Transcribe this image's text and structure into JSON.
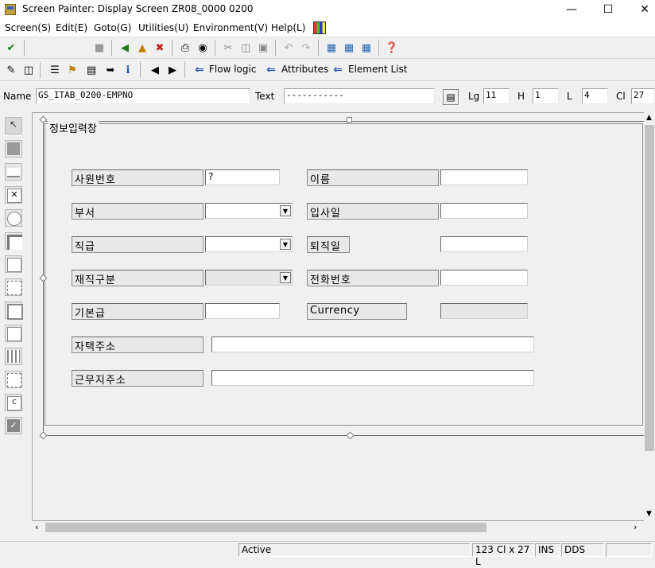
{
  "window": {
    "title": "Screen Painter:  Display Screen ZR08_0000 0200"
  },
  "menubar": {
    "items": [
      "Screen(S)",
      "Edit(E)",
      "Goto(G)",
      "Utilities(U)",
      "Environment(V)",
      "Help(L)"
    ]
  },
  "toolbar2": {
    "flow_logic": "Flow logic",
    "attributes": "Attributes",
    "element_list": "Element List"
  },
  "namerow": {
    "name_label": "Name",
    "name_value": "GS_ITAB_0200-EMPNO",
    "text_label": "Text",
    "text_value": "-----------",
    "lg_label": "Lg",
    "lg_value": "11",
    "h_label": "H",
    "h_value": "1",
    "l_label": "L",
    "l_value": "4",
    "cl_label": "Cl",
    "cl_value": "27"
  },
  "form": {
    "group_title": "정보입력창",
    "fields": {
      "empno_label": "사원번호",
      "empno_value": "?",
      "name_label": "이름",
      "dept_label": "부서",
      "hire_label": "입사일",
      "rank_label": "직급",
      "retire_label": "퇴직일",
      "status_label": "재직구분",
      "phone_label": "전화번호",
      "salary_label": "기본급",
      "currency_label": "Currency",
      "home_label": "자택주소",
      "work_label": "근무지주소"
    }
  },
  "status": {
    "mode": "Active",
    "position": "123 Cl x 27 L",
    "ins": "INS",
    "dds": "DDS"
  }
}
